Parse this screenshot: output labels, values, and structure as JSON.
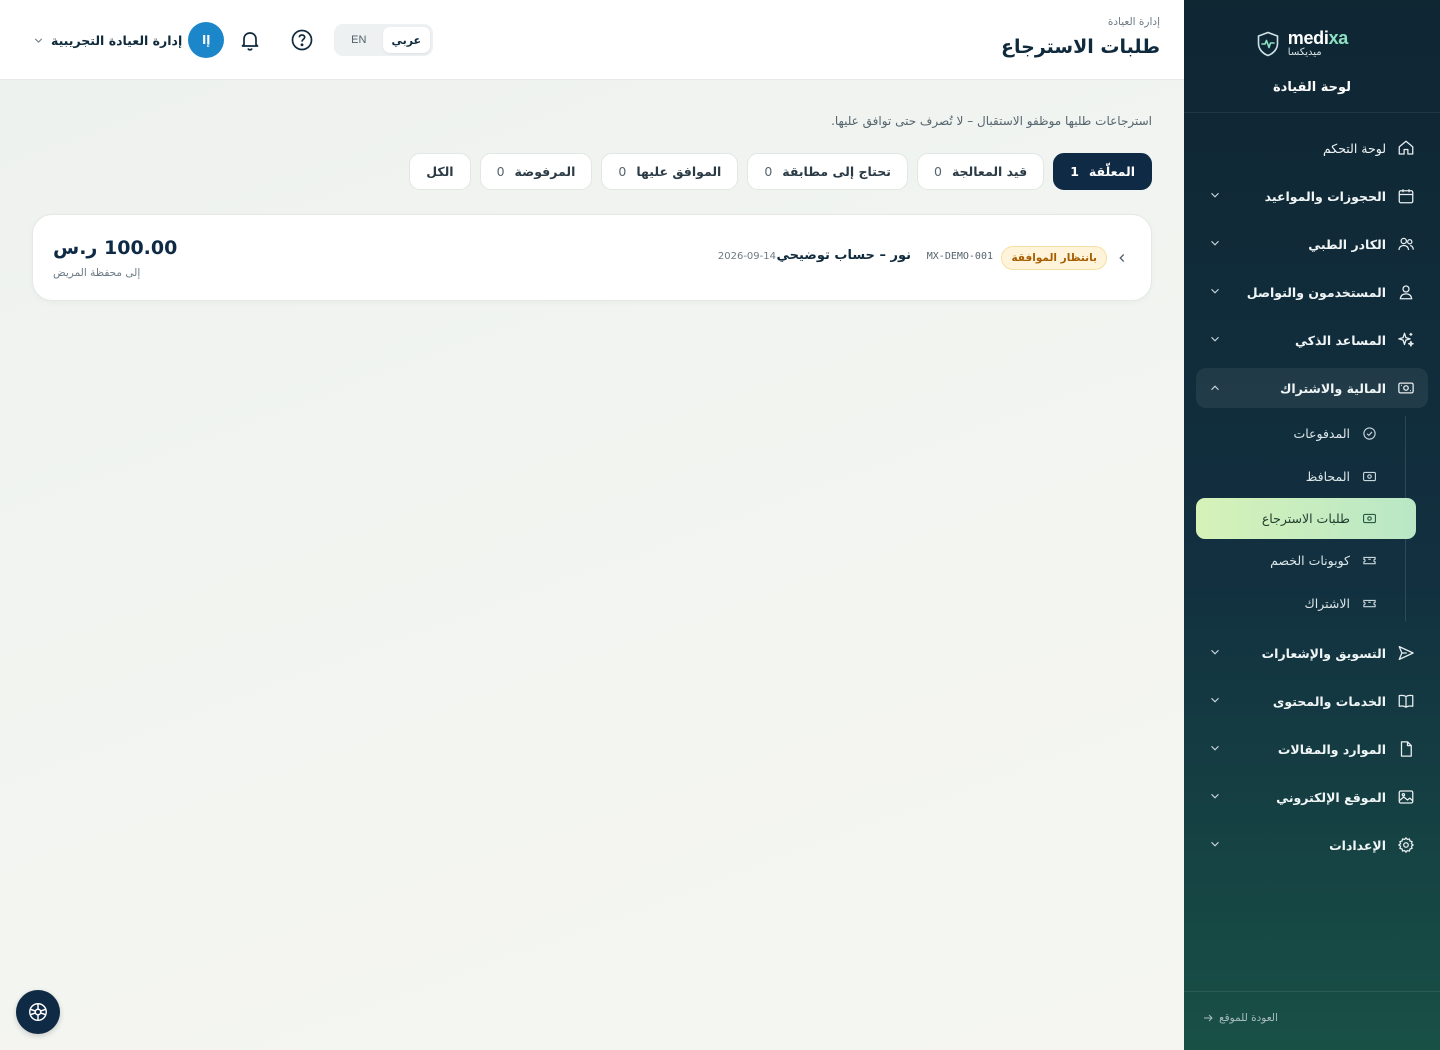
{
  "brand": {
    "name_prefix": "medi",
    "name_suffix": "xa",
    "name_ar": "ميديكسا",
    "subtitle": "لوحة القيادة"
  },
  "sidebar": {
    "items": [
      {
        "label": "لوحة التحكم",
        "icon": "home-icon"
      },
      {
        "label": "الحجوزات والمواعيد",
        "icon": "calendar-icon"
      },
      {
        "label": "الكادر الطبي",
        "icon": "users-icon"
      },
      {
        "label": "المستخدمون والتواصل",
        "icon": "user-icon"
      },
      {
        "label": "المساعد الذكي",
        "icon": "sparkles-icon"
      },
      {
        "label": "المالية والاشتراك",
        "icon": "banknote-icon",
        "children": [
          {
            "label": "المدفوعات",
            "icon": "check-circle-icon"
          },
          {
            "label": "المحافظ",
            "icon": "wallet-icon"
          },
          {
            "label": "طلبات الاسترجاع",
            "icon": "refund-icon"
          },
          {
            "label": "كوبونات الخصم",
            "icon": "ticket-icon"
          },
          {
            "label": "الاشتراك",
            "icon": "ticket-icon"
          }
        ]
      },
      {
        "label": "التسويق والإشعارات",
        "icon": "send-icon"
      },
      {
        "label": "الخدمات والمحتوى",
        "icon": "book-icon"
      },
      {
        "label": "الموارد والمقالات",
        "icon": "file-icon"
      },
      {
        "label": "الموقع الإلكتروني",
        "icon": "image-icon"
      },
      {
        "label": "الإعدادات",
        "icon": "gear-icon"
      }
    ],
    "footer_link": "العودة للموقع"
  },
  "header": {
    "breadcrumb": "إدارة العيادة",
    "title": "طلبات الاسترجاع",
    "lang_ar": "عربي",
    "lang_en": "EN",
    "user_initials": "إا",
    "user_name": "إدارة العيادة التجريبية"
  },
  "main": {
    "subtitle": "استرجاعات طلبها موظفو الاستقبال – لا تُصرف حتى توافق عليها.",
    "tabs": [
      {
        "label": "المعلّقة",
        "count": "1",
        "active": true
      },
      {
        "label": "قيد المعالجة",
        "count": "0"
      },
      {
        "label": "تحتاج إلى مطابقة",
        "count": "0"
      },
      {
        "label": "الموافق عليها",
        "count": "0"
      },
      {
        "label": "المرفوضة",
        "count": "0"
      },
      {
        "label": "الكل",
        "count": ""
      }
    ],
    "refund": {
      "status": "بانتظار الموافقة",
      "reference": "MX-DEMO-001",
      "patient": "نور – حساب توضيحي",
      "date": "2026-09-14",
      "amount": "100.00 ر.س",
      "destination": "إلى محفظة المريض"
    }
  },
  "colors": {
    "accent": "#0f2a44",
    "active_nav": "#c9efbf",
    "avatar": "#1b86c9",
    "status_bg": "#fff4d9",
    "status_text": "#a55d00"
  }
}
